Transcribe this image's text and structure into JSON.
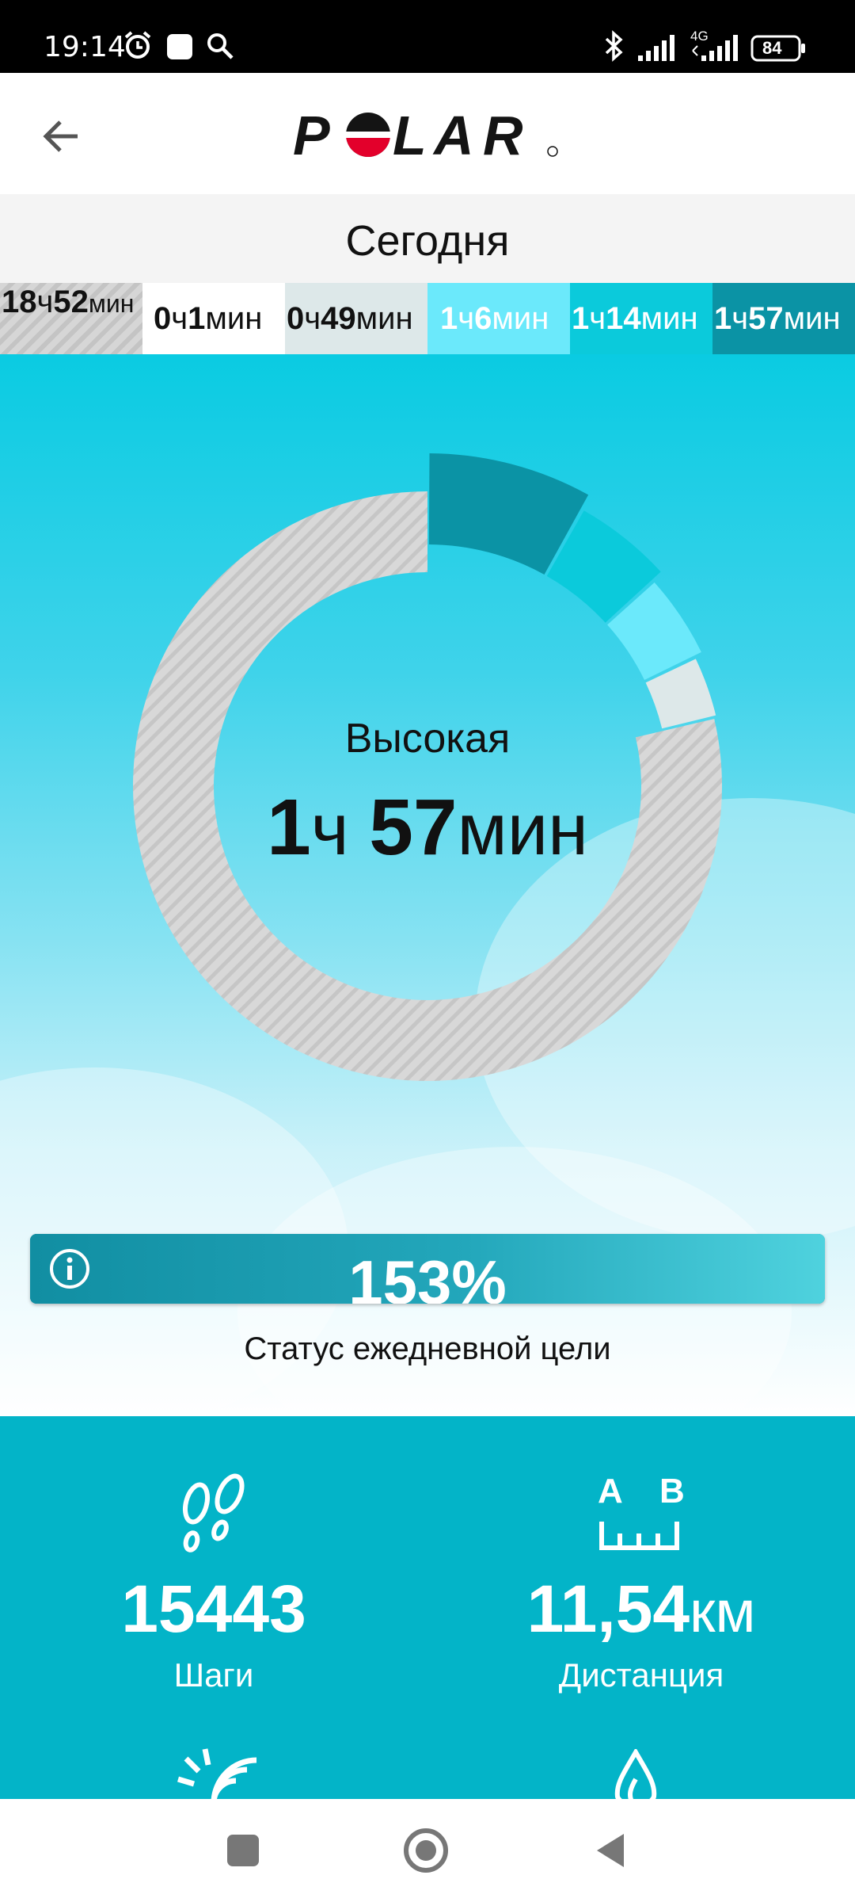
{
  "status_bar": {
    "time": "19:14",
    "battery": "84",
    "network": "4G"
  },
  "header": {
    "logo_text": "POLAR",
    "back_icon": "arrow-left-icon"
  },
  "date_bar": {
    "title": "Сегодня"
  },
  "zones": [
    {
      "h": "18",
      "h_unit": "ч",
      "m": "52",
      "m_unit": "мин"
    },
    {
      "h": "0",
      "h_unit": "ч",
      "m": "1",
      "m_unit": "мин"
    },
    {
      "h": "0",
      "h_unit": "ч",
      "m": "49",
      "m_unit": "мин"
    },
    {
      "h": "1",
      "h_unit": "ч",
      "m": "6",
      "m_unit": "мин"
    },
    {
      "h": "1",
      "h_unit": "ч",
      "m": "14",
      "m_unit": "мин"
    },
    {
      "h": "1",
      "h_unit": "ч",
      "m": "57",
      "m_unit": "мин"
    }
  ],
  "activity_ring": {
    "label": "Высокая",
    "hours": "1",
    "hours_unit": "ч",
    "minutes": "57",
    "minutes_unit": "мин",
    "segments_minutes": {
      "rest": 1132,
      "very_light": 1,
      "light": 49,
      "medium": 66,
      "moderate": 74,
      "high": 117
    }
  },
  "goal": {
    "percent": "153%",
    "caption": "Статус ежедневной цели",
    "info_icon": "info-icon"
  },
  "stats": {
    "steps": {
      "value": "15443",
      "label": "Шаги",
      "icon": "footprints-icon"
    },
    "distance": {
      "value": "11,54",
      "unit": "км",
      "label": "Дистанция",
      "icon": "distance-icon",
      "icon_a": "A",
      "icon_b": "B"
    },
    "calories_icon": "sun-icon",
    "flame_icon": "flame-icon"
  },
  "colors": {
    "zone_high": "#0b93a5",
    "zone_moderate": "#0bcadb",
    "zone_medium": "#6be9fb",
    "zone_light": "#dde8e9",
    "stats_bg": "#03b4c8",
    "polar_red": "#e3002b"
  }
}
